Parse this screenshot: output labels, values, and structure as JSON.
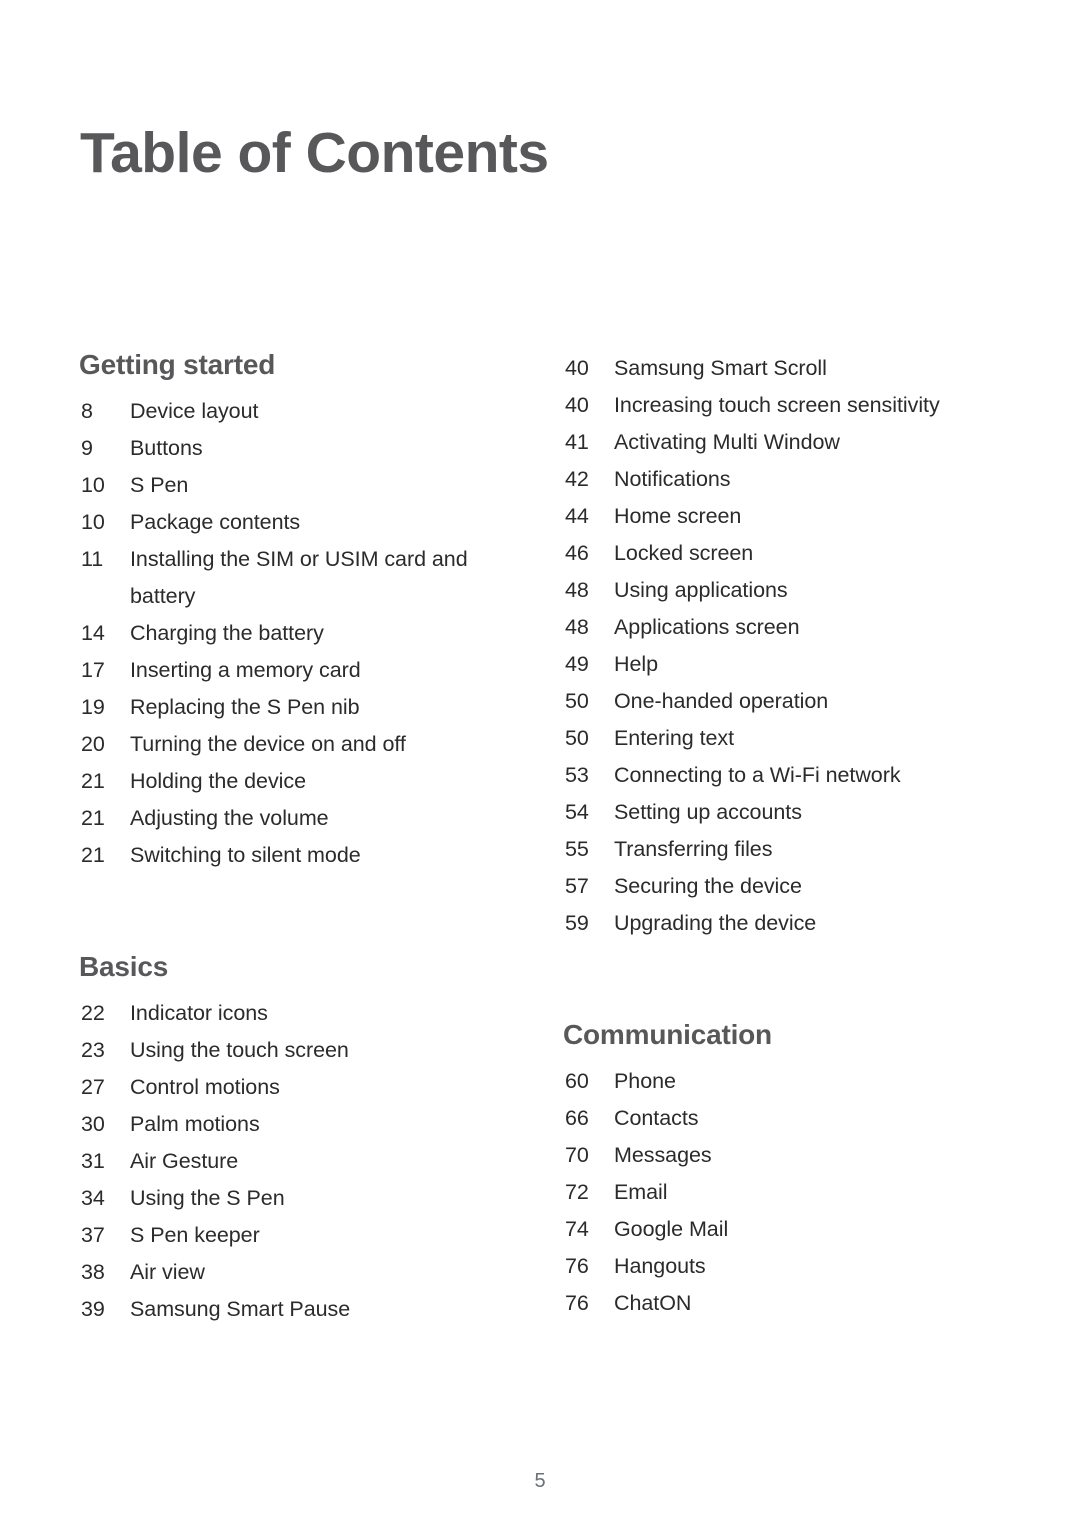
{
  "document": {
    "title": "Table of Contents",
    "page_number": "5"
  },
  "colors": {
    "heading": "#58585b",
    "body_text": "#2b2b2b",
    "folio": "#6b7074",
    "background": "#ffffff"
  },
  "columns": [
    {
      "name": "left-column",
      "sections": [
        {
          "heading": "Getting started",
          "entries": [
            {
              "page": "8",
              "title": "Device layout"
            },
            {
              "page": "9",
              "title": "Buttons"
            },
            {
              "page": "10",
              "title": "S Pen"
            },
            {
              "page": "10",
              "title": "Package contents"
            },
            {
              "page": "11",
              "title": "Installing the SIM or USIM card and battery"
            },
            {
              "page": "14",
              "title": "Charging the battery"
            },
            {
              "page": "17",
              "title": "Inserting a memory card"
            },
            {
              "page": "19",
              "title": "Replacing the S Pen nib"
            },
            {
              "page": "20",
              "title": "Turning the device on and off"
            },
            {
              "page": "21",
              "title": "Holding the device"
            },
            {
              "page": "21",
              "title": "Adjusting the volume"
            },
            {
              "page": "21",
              "title": "Switching to silent mode"
            }
          ]
        },
        {
          "heading": "Basics",
          "entries": [
            {
              "page": "22",
              "title": "Indicator icons"
            },
            {
              "page": "23",
              "title": "Using the touch screen"
            },
            {
              "page": "27",
              "title": "Control motions"
            },
            {
              "page": "30",
              "title": "Palm motions"
            },
            {
              "page": "31",
              "title": "Air Gesture"
            },
            {
              "page": "34",
              "title": "Using the S Pen"
            },
            {
              "page": "37",
              "title": "S Pen keeper"
            },
            {
              "page": "38",
              "title": "Air view"
            },
            {
              "page": "39",
              "title": "Samsung Smart Pause"
            }
          ]
        }
      ]
    },
    {
      "name": "right-column",
      "sections": [
        {
          "heading": "",
          "entries": [
            {
              "page": "40",
              "title": "Samsung Smart Scroll"
            },
            {
              "page": "40",
              "title": "Increasing touch screen sensitivity"
            },
            {
              "page": "41",
              "title": "Activating Multi Window"
            },
            {
              "page": "42",
              "title": "Notifications"
            },
            {
              "page": "44",
              "title": "Home screen"
            },
            {
              "page": "46",
              "title": "Locked screen"
            },
            {
              "page": "48",
              "title": "Using applications"
            },
            {
              "page": "48",
              "title": "Applications screen"
            },
            {
              "page": "49",
              "title": "Help"
            },
            {
              "page": "50",
              "title": "One-handed operation"
            },
            {
              "page": "50",
              "title": "Entering text"
            },
            {
              "page": "53",
              "title": "Connecting to a Wi-Fi network"
            },
            {
              "page": "54",
              "title": "Setting up accounts"
            },
            {
              "page": "55",
              "title": "Transferring files"
            },
            {
              "page": "57",
              "title": "Securing the device"
            },
            {
              "page": "59",
              "title": "Upgrading the device"
            }
          ]
        },
        {
          "heading": "Communication",
          "entries": [
            {
              "page": "60",
              "title": "Phone"
            },
            {
              "page": "66",
              "title": "Contacts"
            },
            {
              "page": "70",
              "title": "Messages"
            },
            {
              "page": "72",
              "title": "Email"
            },
            {
              "page": "74",
              "title": "Google Mail"
            },
            {
              "page": "76",
              "title": "Hangouts"
            },
            {
              "page": "76",
              "title": "ChatON"
            }
          ]
        }
      ]
    }
  ]
}
